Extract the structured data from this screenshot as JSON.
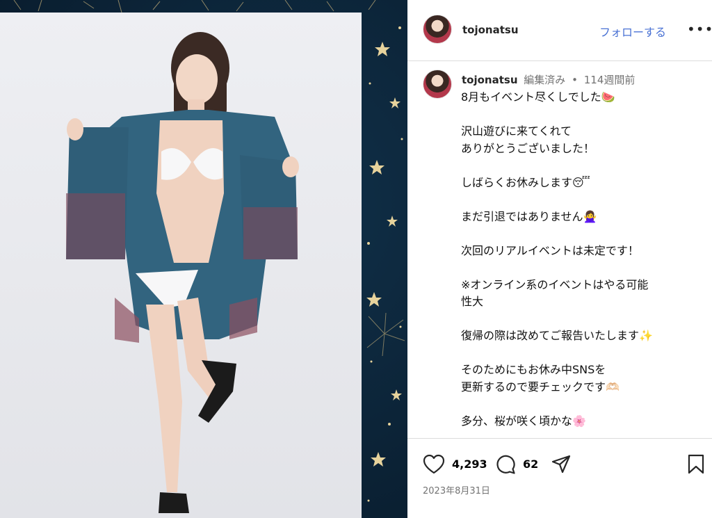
{
  "header": {
    "username": "tojonatsu",
    "follow_label": "フォローする",
    "more_label": "•••"
  },
  "caption_block": {
    "username": "tojonatsu",
    "edited_label": "編集済み",
    "separator": "•",
    "time_ago": "114週間前",
    "text": "8月もイベント尽くしでした🍉\n\n沢山遊びに来てくれて\nありがとうございました！\n\nしばらくお休みします😴\n\nまだ引退ではありません🙅‍♀️\n\n次回のリアルイベントは未定です！\n\n※オンライン系のイベントはやる可能\n性大\n\n復帰の際は改めてご報告いたします✨\n\nそのためにもお休み中SNSを\n更新するので要チェックです🫶🏻\n\n多分、桜が咲く頃かな🌸"
  },
  "actions": {
    "like_count": "4,293",
    "comment_count": "62",
    "icons": [
      "heart-icon",
      "comment-icon",
      "share-icon",
      "bookmark-icon"
    ]
  },
  "post_date": "2023年8月31日",
  "colors": {
    "follow_link": "#4a72d4",
    "media_background": "#0c2438",
    "secondary_text": "#737373",
    "divider": "#dbdbdb"
  }
}
